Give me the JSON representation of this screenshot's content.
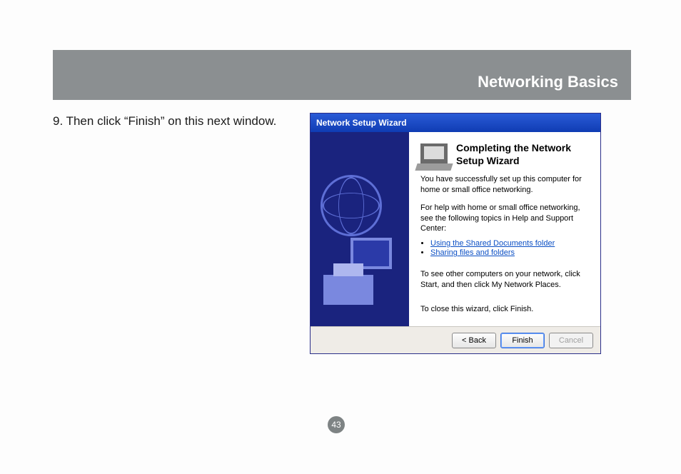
{
  "header": {
    "title": "Networking Basics"
  },
  "instruction": "9. Then click “Finish” on this next window.",
  "wizard": {
    "titlebar": "Network Setup Wizard",
    "heading": "Completing the Network Setup Wizard",
    "p1": "You have successfully set up this computer for home or small office networking.",
    "p2": "For help with home or small office networking, see the following topics in Help and Support Center:",
    "links": {
      "shared_docs": "Using the Shared Documents folder",
      "sharing": "Sharing files and folders"
    },
    "p3": "To see other computers on your network, click Start, and then click My Network Places.",
    "close_hint": "To close this wizard, click Finish.",
    "buttons": {
      "back": "< Back",
      "finish": "Finish",
      "cancel": "Cancel"
    }
  },
  "pageNumber": "43"
}
